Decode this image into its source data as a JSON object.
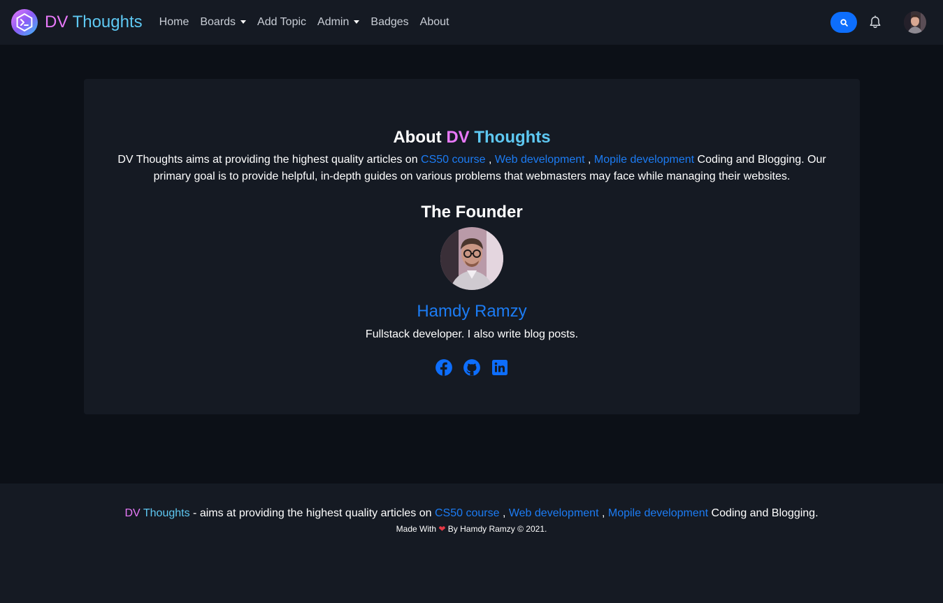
{
  "navbar": {
    "brand": {
      "dv": "DV",
      "thoughts": "Thoughts",
      "logo_icon": "terminal-hexagon-icon"
    },
    "links": [
      {
        "label": "Home"
      },
      {
        "label": "Boards",
        "dropdown": true
      },
      {
        "label": "Add Topic"
      },
      {
        "label": "Admin",
        "dropdown": true
      },
      {
        "label": "Badges"
      },
      {
        "label": "About"
      }
    ],
    "search_icon": "search-icon",
    "bell_icon": "bell-icon",
    "avatar": "user-avatar"
  },
  "about": {
    "title_prefix": "About",
    "title_dv": "DV",
    "title_thoughts": "Thoughts",
    "desc_start": "DV Thoughts aims at providing the highest quality articles on",
    "link_cs50": "CS50 course",
    "sep1": " , ",
    "link_web": "Web development",
    "sep2": " , ",
    "link_mobile": "Mopile development",
    "desc_end": " Coding and Blogging. Our primary goal is to provide helpful, in-depth guides on various problems that webmasters may face while managing their websites."
  },
  "founder": {
    "heading": "The Founder",
    "name": "Hamdy Ramzy",
    "role": "Fullstack developer. I also write blog posts.",
    "socials": [
      "facebook-icon",
      "github-icon",
      "linkedin-icon"
    ]
  },
  "footer": {
    "dv": "DV",
    "thoughts": "Thoughts",
    "text1": " - aims at providing the highest quality articles on ",
    "link_cs50": "CS50 course",
    "sep1": " , ",
    "link_web": "Web development",
    "sep2": " , ",
    "link_mobile": "Mopile development",
    "text2": " Coding and Blogging.",
    "made_with": "Made With",
    "by_line": "By Hamdy Ramzy © 2021."
  },
  "colors": {
    "background": "#0c1017",
    "surface": "#151a23",
    "link": "#1c7cf4",
    "brand_pink": "#e879f9",
    "brand_cyan": "#5ec8f2",
    "primary_button": "#0d6efd"
  }
}
